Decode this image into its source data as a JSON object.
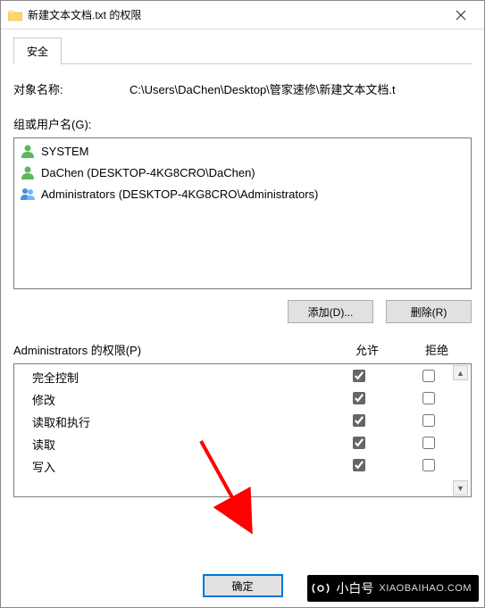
{
  "window": {
    "title": "新建文本文档.txt 的权限"
  },
  "tab": {
    "security": "安全"
  },
  "object": {
    "label": "对象名称:",
    "value": "C:\\Users\\DaChen\\Desktop\\管家速修\\新建文本文档.t"
  },
  "groups": {
    "label": "组或用户名(G):",
    "items": [
      {
        "name": "SYSTEM",
        "type": "single"
      },
      {
        "name": "DaChen (DESKTOP-4KG8CRO\\DaChen)",
        "type": "single"
      },
      {
        "name": "Administrators (DESKTOP-4KG8CRO\\Administrators)",
        "type": "group"
      }
    ]
  },
  "buttons": {
    "add": "添加(D)...",
    "remove": "删除(R)",
    "ok": "确定"
  },
  "permissions": {
    "label": "Administrators 的权限(P)",
    "allow": "允许",
    "deny": "拒绝",
    "rows": [
      {
        "name": "完全控制",
        "allow": true,
        "deny": false
      },
      {
        "name": "修改",
        "allow": true,
        "deny": false
      },
      {
        "name": "读取和执行",
        "allow": true,
        "deny": false
      },
      {
        "name": "读取",
        "allow": true,
        "deny": false
      },
      {
        "name": "写入",
        "allow": true,
        "deny": false
      }
    ]
  },
  "watermark": {
    "brand": "小白号",
    "domain": "XIAOBAIHAO.COM"
  }
}
